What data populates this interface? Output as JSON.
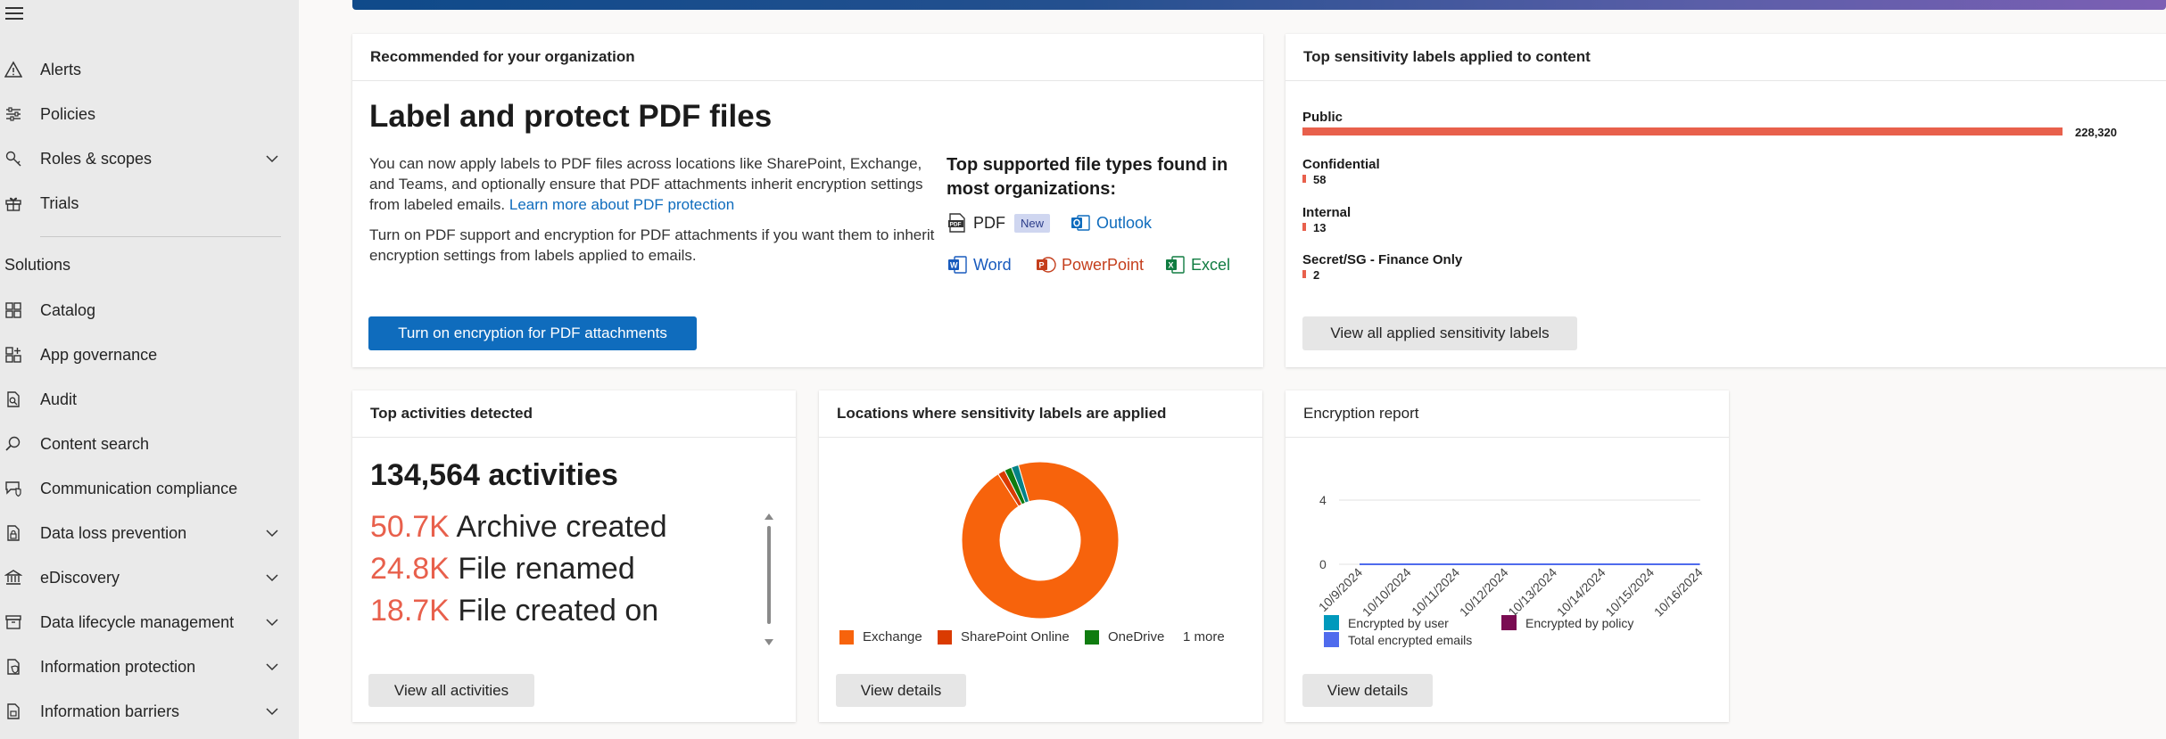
{
  "sidebar": {
    "items": [
      {
        "label": "Alerts",
        "icon": "warning-icon"
      },
      {
        "label": "Policies",
        "icon": "sliders-icon"
      },
      {
        "label": "Roles & scopes",
        "icon": "key-icon",
        "expandable": true
      },
      {
        "label": "Trials",
        "icon": "gift-icon"
      }
    ],
    "section_title": "Solutions",
    "solutions": [
      {
        "label": "Catalog",
        "icon": "grid-icon"
      },
      {
        "label": "App governance",
        "icon": "grid-add-icon"
      },
      {
        "label": "Audit",
        "icon": "document-search-icon"
      },
      {
        "label": "Content search",
        "icon": "search-icon"
      },
      {
        "label": "Communication compliance",
        "icon": "chat-shield-icon"
      },
      {
        "label": "Data loss prevention",
        "icon": "document-lock-icon",
        "expandable": true
      },
      {
        "label": "eDiscovery",
        "icon": "building-icon",
        "expandable": true
      },
      {
        "label": "Data lifecycle management",
        "icon": "archive-icon",
        "expandable": true
      },
      {
        "label": "Information protection",
        "icon": "document-shield-icon",
        "expandable": true
      },
      {
        "label": "Information barriers",
        "icon": "barrier-icon",
        "expandable": true
      }
    ]
  },
  "recommended": {
    "header": "Recommended for your organization",
    "title": "Label and protect PDF files",
    "para1": "You can now apply labels to PDF files across locations like SharePoint, Exchange, and Teams, and optionally ensure that PDF attachments inherit encryption settings from labeled emails.",
    "para1_link": "Learn more about PDF protection",
    "para2": "Turn on PDF support and encryption for PDF attachments if you want them to inherit encryption settings from labels applied to emails.",
    "file_types_title": "Top supported file types found in most organizations:",
    "file_types": {
      "pdf": "PDF",
      "pdf_badge": "New",
      "outlook": "Outlook",
      "word": "Word",
      "powerpoint": "PowerPoint",
      "excel": "Excel"
    },
    "button": "Turn on encryption for PDF attachments"
  },
  "sensitivity": {
    "header": "Top sensitivity labels applied to content",
    "labels": [
      {
        "name": "Public",
        "value": "228,320",
        "count": 228320
      },
      {
        "name": "Confidential",
        "value": "58",
        "count": 58
      },
      {
        "name": "Internal",
        "value": "13",
        "count": 13
      },
      {
        "name": "Secret/SG - Finance Only",
        "value": "2",
        "count": 2
      }
    ],
    "button": "View all applied sensitivity labels",
    "bar_color": "#e8604c"
  },
  "activities": {
    "header": "Top activities detected",
    "total": "134,564 activities",
    "items": [
      {
        "count": "50.7K",
        "label": "Archive created"
      },
      {
        "count": "24.8K",
        "label": "File renamed"
      },
      {
        "count": "18.7K",
        "label": "File created on removable media"
      }
    ],
    "button": "View all activities"
  },
  "locations": {
    "header": "Locations where sensitivity labels are applied",
    "legend": [
      {
        "label": "Exchange",
        "color": "#f7630c"
      },
      {
        "label": "SharePoint Online",
        "color": "#da3b01"
      },
      {
        "label": "OneDrive",
        "color": "#107c10"
      }
    ],
    "more": "1 more",
    "button": "View details"
  },
  "encryption": {
    "header": "Encryption report",
    "y_ticks": [
      "4",
      "0"
    ],
    "x_ticks": [
      "10/9/2024",
      "10/10/2024",
      "10/11/2024",
      "10/12/2024",
      "10/13/2024",
      "10/14/2024",
      "10/15/2024",
      "10/16/2024"
    ],
    "legend": [
      {
        "label": "Encrypted by user",
        "color": "#0099bc"
      },
      {
        "label": "Encrypted by policy",
        "color": "#7a0c52"
      },
      {
        "label": "Total encrypted emails",
        "color": "#4f6bed"
      }
    ],
    "button": "View details"
  },
  "chart_data": [
    {
      "type": "bar",
      "title": "Top sensitivity labels applied to content",
      "categories": [
        "Public",
        "Confidential",
        "Internal",
        "Secret/SG - Finance Only"
      ],
      "values": [
        228320,
        58,
        13,
        2
      ]
    },
    {
      "type": "pie",
      "title": "Locations where sensitivity labels are applied",
      "categories": [
        "Exchange",
        "SharePoint Online",
        "OneDrive",
        "other"
      ],
      "values": [
        95.5,
        1.5,
        1.5,
        1.5
      ],
      "colors": [
        "#f7630c",
        "#da3b01",
        "#107c10",
        "#038387"
      ]
    },
    {
      "type": "line",
      "title": "Encryption report",
      "x": [
        "10/9/2024",
        "10/10/2024",
        "10/11/2024",
        "10/12/2024",
        "10/13/2024",
        "10/14/2024",
        "10/15/2024",
        "10/16/2024"
      ],
      "series": [
        {
          "name": "Encrypted by user",
          "values": [
            0,
            0,
            0,
            0,
            0,
            0,
            0,
            0
          ]
        },
        {
          "name": "Encrypted by policy",
          "values": [
            0,
            0,
            0,
            0,
            0,
            0,
            0,
            0
          ]
        },
        {
          "name": "Total encrypted emails",
          "values": [
            0,
            0,
            0,
            0,
            0,
            0,
            0,
            0
          ]
        }
      ],
      "ylim": [
        0,
        4
      ]
    }
  ]
}
